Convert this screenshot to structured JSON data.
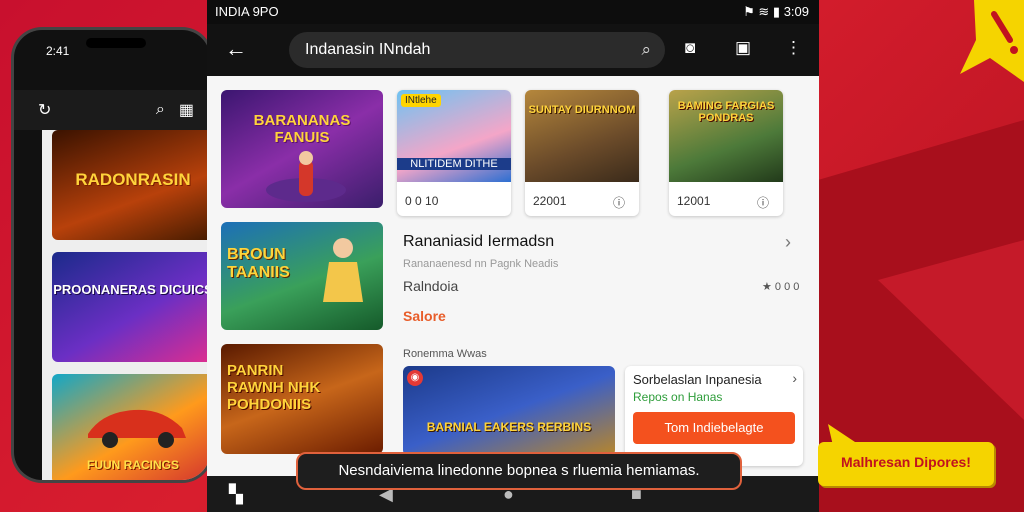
{
  "phone": {
    "time": "2:41",
    "tiles": [
      {
        "label": "RADONRASIN"
      },
      {
        "label": "PROONANERAS DICUICS"
      },
      {
        "label": "FUUN RACINGS"
      }
    ]
  },
  "status_bar": {
    "carrier": "INDIA 9PO",
    "time": "3:09"
  },
  "app_bar": {
    "search_value": "Indanasin INndah"
  },
  "banners": [
    {
      "label": "BARANANAS FANUIS"
    },
    {
      "label": "BROUN TAANIIS"
    },
    {
      "label": "PANRIN RAWNH NHK POHDONIIS"
    }
  ],
  "cards": [
    {
      "badge": "INtlehe",
      "label": "NLITIDEM DITHE",
      "meta": "0 0 10"
    },
    {
      "label": "SUNTAY DIURNNOM",
      "meta": "22001"
    },
    {
      "label": "BAMING FARGIAS PONDRAS",
      "meta": "12001"
    }
  ],
  "info": {
    "title": "Rananiasid Iermadsn",
    "subtitle": "Rananaenesd nn Pagnk Neadis",
    "row": "Ralndoia",
    "rating": "★ 0 0 0",
    "price": "Salore"
  },
  "section_label": "Ronemma Wwas",
  "bottom_banner": {
    "label": "BARNIAL EAKERS RERBINS"
  },
  "promo": {
    "title": "Sorbelaslan Inpanesia",
    "subtitle": "Repos on Hanas",
    "button": "Tom Indiebelagte"
  },
  "toast": {
    "text": "Nesndaiviema linedonne bopnea  s rluemia hemiamas."
  },
  "callout": {
    "text": "Malhresan Dipores!"
  },
  "colors": {
    "accent": "#f4511e",
    "background": "#c8102e",
    "callout": "#f5d400"
  }
}
